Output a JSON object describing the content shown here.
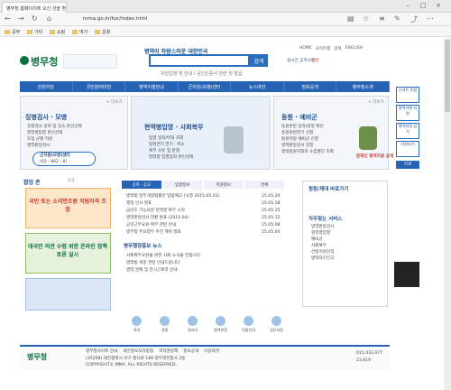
{
  "browser": {
    "tab_title": "병무청 홈페이지에 오신 것을 환영",
    "url": "mma.go.kr/kor/index.html",
    "favorites": [
      "공부",
      "기타",
      "쇼핑",
      "여가",
      "운항"
    ]
  },
  "header": {
    "logo_text": "병무청",
    "slogan": "병역이 자랑스러운 대한민국",
    "search_button": "검색",
    "search_hint": "자원입영 및 안내 l 공인인증서 관련 및 발급",
    "top_links": [
      "HOME",
      "사이트맵",
      "검색",
      "ENGLISH"
    ],
    "side_links": [
      "실시간 공지사항",
      "민원"
    ]
  },
  "gnb": [
    "민원마당",
    "국민참여마당",
    "병역이행안내",
    "군지원(모병)센터",
    "뉴스마당",
    "정보공개",
    "병무청소개"
  ],
  "left_panel": {
    "title": "징병검사 · 모병",
    "items": [
      "징병검사 일자 및 장소 본인선택",
      "현역병입영 본인선택",
      "모집 군별 지원",
      "병역판정검사"
    ],
    "center_label": "군지원(모병)센터",
    "center_phone": "(02 - 862 - 8)"
  },
  "center_panel": {
    "title": "현역병입영 · 사회복무",
    "items": [
      "입영 일자/부대 조회",
      "입영연기 연기 · 취소",
      "복무 사유 및 분쟁",
      "현역병 입영일자 본인선택"
    ]
  },
  "right_panel": {
    "title": "동원 · 예비군",
    "items": [
      "동원훈련 일자/일정 확인",
      "동원훈련연기 신청",
      "동원지정 예비군 신청",
      "병역판정검사 일정",
      "병력동원지정자 소집명단 조회"
    ],
    "badge": "문화인 병역지원 공개"
  },
  "popup": {
    "title": "팝업 존",
    "page": "1/3",
    "items": [
      "국민 또는 소리면조원 지원자격 조정",
      "대국민 의견 수렴 위한 온라인 정책토론 실시"
    ]
  },
  "news": {
    "tabs": [
      "공지 · 공고",
      "입영정보",
      "지원정보",
      "전체"
    ],
    "items": [
      "병역법 일부개정법률안 입법예고 (시행 2015.05.01)",
      "행정 인사 발표",
      "금년도 기능요원 현역병 복무 시작",
      "병역판정검사 현황 발표 (2015.04)",
      "공익근무요원 복무 관련 안내",
      "병무청 주요업무 추진 계획 발표"
    ],
    "dates": [
      "15.05.20",
      "15.05.18",
      "15.05.15",
      "15.05.12",
      "15.05.08",
      "15.05.04"
    ]
  },
  "event_news": {
    "title": "병무행정홍보 뉴스",
    "items": [
      "사회복무요원을 위한 사회 소식을 전합니다",
      "병역법 개정 관련 안내드립니다",
      "병역 면제 및 전시근로역 안내"
    ]
  },
  "side_service": {
    "title": "자주찾는 서비스",
    "links": [
      "병역판정검사",
      "현역병입영",
      "예비군",
      "사회복무",
      "산업지원인력",
      "병역자진신고"
    ],
    "apply_title": "청원/제대 바로가기"
  },
  "bottom_icons": [
    "육아",
    "경병",
    "일자리",
    "병역판정",
    "민원안내",
    "업무지원"
  ],
  "footer": {
    "logo": "병무청",
    "links": [
      "병무청사이트 안내",
      "개인정보처리방침",
      "저작권정책",
      "정보공개",
      "이용약관"
    ],
    "address": "(35208) 대전광역시 서구 청사로 189 정부대전청사 2동",
    "copyright": "COPYRIGHT© MMA. ALL RIGHTS RESERVED.",
    "visitors": [
      "015,432,077",
      "23,819"
    ]
  },
  "right_rail": [
    "스마트 민원",
    "병역이행 지원",
    "병역판정 검사",
    "지원보기",
    "TOP"
  ],
  "colors": {
    "primary": "#2763b5",
    "logo_green": "#0b6e3d",
    "accent_orange": "#e88b1f"
  }
}
